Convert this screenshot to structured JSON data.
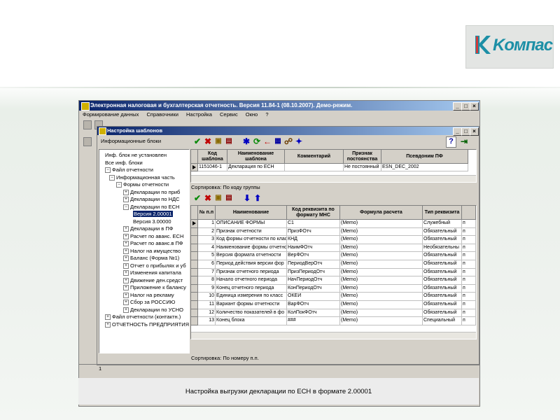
{
  "logo": {
    "text": "Kомпас",
    "color": "#1c8fa6"
  },
  "caption": "Настройка выгрузки декларации по ЕСН в формате 2.00001",
  "app": {
    "title": "Электронная налоговая и бухгалтерская отчетность. Версия 11.84-1 (08.10.2007). Демо-режим.",
    "menu": [
      "Формирование данных",
      "Справочники",
      "Настройка",
      "Сервис",
      "Окно",
      "?"
    ],
    "status_number": "1"
  },
  "child": {
    "title": "Настройка шаблонов",
    "toolbar_label": "Информационные блоки",
    "tree": [
      {
        "label": "Инф. блок не установлен",
        "level": 0,
        "toggle": ""
      },
      {
        "label": "Все инф. блоки",
        "level": 0,
        "toggle": ""
      },
      {
        "label": "Файл отчетности",
        "level": 0,
        "toggle": "−"
      },
      {
        "label": "Информационная часть",
        "level": 1,
        "toggle": "−"
      },
      {
        "label": "Формы отчетности",
        "level": 2,
        "toggle": "−"
      },
      {
        "label": "Декларации по приб",
        "level": 3,
        "toggle": "+"
      },
      {
        "label": "Декларации по НДС",
        "level": 3,
        "toggle": "+"
      },
      {
        "label": "Декларации по ЕСН",
        "level": 3,
        "toggle": "−"
      },
      {
        "label": "Версия 2.00001",
        "level": 4,
        "toggle": "",
        "selected": true
      },
      {
        "label": "Версия 3.00000",
        "level": 4,
        "toggle": ""
      },
      {
        "label": "Декларации в ПФ",
        "level": 3,
        "toggle": "+"
      },
      {
        "label": "Расчет по аванс. ЕСН",
        "level": 3,
        "toggle": "+"
      },
      {
        "label": "Расчет по аванс.в ПФ",
        "level": 3,
        "toggle": "+"
      },
      {
        "label": "Налог на имущество",
        "level": 3,
        "toggle": "+"
      },
      {
        "label": "Баланс (Форма №1)",
        "level": 3,
        "toggle": "+"
      },
      {
        "label": "Отчет о прибылях и уб",
        "level": 3,
        "toggle": "+"
      },
      {
        "label": "Изменения капитала",
        "level": 3,
        "toggle": "+"
      },
      {
        "label": "Движение ден.средст",
        "level": 3,
        "toggle": "+"
      },
      {
        "label": "Приложение к балансу",
        "level": 3,
        "toggle": "+"
      },
      {
        "label": "Налог на рекламу",
        "level": 3,
        "toggle": "+"
      },
      {
        "label": "Сбор за РОССИЮ",
        "level": 3,
        "toggle": "+"
      },
      {
        "label": "Декларации по УСНО",
        "level": 3,
        "toggle": "+"
      },
      {
        "label": "Файл отчетности (контактн.)",
        "level": 0,
        "toggle": "+"
      },
      {
        "label": "ОТЧЕТНОСТЬ ПРЕДПРИЯТИЯ",
        "level": 0,
        "toggle": "+"
      }
    ],
    "top_grid": {
      "headers": [
        "Код шаблона",
        "Наименование шаблона",
        "Комментарий",
        "Признак постоянства",
        "Псевдоним ПФ"
      ],
      "rows": [
        [
          "1151046-1",
          "Декларация по ЕСН",
          "",
          "Не постоянный",
          "ESN_DEC_2002"
        ]
      ],
      "sort_label": "Сортировка: По коду группы"
    },
    "bottom_grid": {
      "headers": [
        "№ п.п",
        "Наименование",
        "Код реквизита по формату МНС",
        "Формула расчета",
        "Тип реквизита"
      ],
      "rows": [
        [
          "1",
          "ОПИСАНИЕ ФОРМЫ",
          "С1",
          "(Memo)",
          "Служебный"
        ],
        [
          "2",
          "Признак отчетности",
          "ПризФОтч",
          "(Memo)",
          "Обязательный"
        ],
        [
          "3",
          "Код формы отчетности по клас",
          "КНД",
          "(Memo)",
          "Обязательный"
        ],
        [
          "4",
          "Наименование формы отчетно",
          "НаимФОтч",
          "(Memo)",
          "Необязательны"
        ],
        [
          "5",
          "Версия формата отчетности",
          "ВерФОтч",
          "(Memo)",
          "Обязательный"
        ],
        [
          "6",
          "Период действия версии фор",
          "ПериодВерОтч",
          "(Memo)",
          "Обязательный"
        ],
        [
          "7",
          "Признак отчетного периода",
          "ПризПериодОтч",
          "(Memo)",
          "Обязательный"
        ],
        [
          "8",
          "Начало отчетного периода",
          "НачПериодОтч",
          "(Memo)",
          "Обязательный"
        ],
        [
          "9",
          "Конец отчетного периода",
          "КонПериодОтч",
          "(Memo)",
          "Обязательный"
        ],
        [
          "10",
          "Единица измерения по класс",
          "ОКЕИ",
          "(Memo)",
          "Обязательный"
        ],
        [
          "11",
          "Вариант формы отчетности",
          "ВарФОтч",
          "(Memo)",
          "Обязательный"
        ],
        [
          "12",
          "Количество показателей в фо",
          "КолПокФОтч",
          "(Memo)",
          "Обязательный"
        ],
        [
          "13",
          "Конец блока",
          "###",
          "(Memo)",
          "Специальный"
        ]
      ],
      "extra_col": "п",
      "sort_label": "Сортировка: По номеру п.п."
    }
  }
}
